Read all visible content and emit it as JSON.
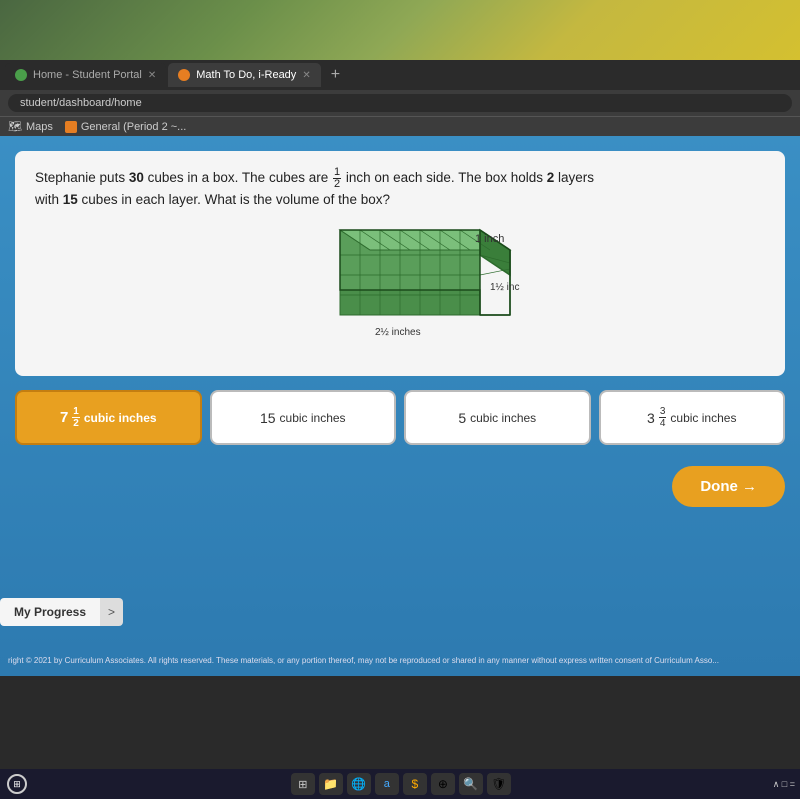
{
  "browser": {
    "tabs": [
      {
        "id": "tab1",
        "label": "Home - Student Portal",
        "active": false,
        "icon": "green"
      },
      {
        "id": "tab2",
        "label": "Math To Do, i-Ready",
        "active": true,
        "icon": "iready"
      }
    ],
    "address": "student/dashboard/home",
    "bookmarks": [
      {
        "label": "Maps"
      },
      {
        "label": "General (Period 2 ~..."
      }
    ],
    "new_tab_symbol": "+"
  },
  "question": {
    "text_parts": {
      "before": "Stephanie puts ",
      "num1": "30",
      "mid1": " cubes in a box. The cubes are ",
      "frac_num": "1",
      "frac_den": "2",
      "mid2": " inch on each side. The box holds ",
      "num2": "2",
      "mid3": " layers",
      "line2": "with ",
      "num3": "15",
      "mid4": " cubes in each layer. What is the volume of the box?"
    },
    "diagram": {
      "label_left": "2",
      "label_left_frac_n": "1",
      "label_left_frac_d": "2",
      "label_left_unit": "inches",
      "label_right": "1",
      "label_right_frac_n": "1",
      "label_right_frac_d": "2",
      "label_right_unit": "inches",
      "label_top": "1 inch"
    }
  },
  "answers": [
    {
      "id": "a1",
      "whole": "7",
      "frac_n": "1",
      "frac_d": "2",
      "unit": "cubic inches",
      "selected": true
    },
    {
      "id": "a2",
      "whole": "15",
      "frac_n": "",
      "frac_d": "",
      "unit": "cubic inches",
      "selected": false
    },
    {
      "id": "a3",
      "whole": "5",
      "frac_n": "",
      "frac_d": "",
      "unit": "cubic inches",
      "selected": false
    },
    {
      "id": "a4",
      "whole": "3",
      "frac_n": "3",
      "frac_d": "4",
      "unit": "cubic inches",
      "selected": false
    }
  ],
  "buttons": {
    "done": "Done →",
    "my_progress": "My Progress",
    "chevron": ">"
  },
  "footer": {
    "copyright": "right © 2021 by Curriculum Associates. All rights reserved. These materials, or any portion thereof, may not be reproduced or shared in any manner without express written consent of Curriculum Asso..."
  },
  "colors": {
    "selected_bg": "#e8a020",
    "main_bg": "#3a8fc4",
    "card_bg": "#f5f5f5",
    "done_btn": "#e8a020"
  }
}
